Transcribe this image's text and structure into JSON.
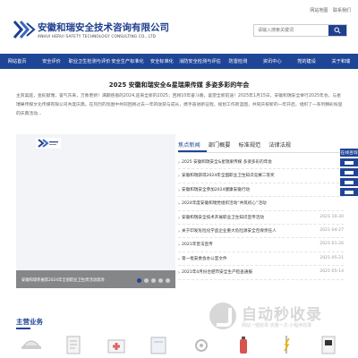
{
  "header": {
    "brand_cn": "安徽和瑞安全技术咨询有限公司",
    "brand_en": "ANHUI HERUI SAFETY TECHNOLOGY CONSULTING CO., LTD",
    "top_links": [
      "网站地图",
      "联系我们"
    ],
    "search_placeholder": "请输入搜索关键词"
  },
  "nav": {
    "items": [
      "网站首页",
      "安全评价",
      "职业卫生检测与评价",
      "安全生产标准化",
      "安全标准化",
      "消防安全检测与评估",
      "防雷检测",
      "资讯中心",
      "党的建设",
      "关于和瑞"
    ]
  },
  "article": {
    "title": "2025 安徽和瑞安全&星瑞果传媒 多姿多彩的年会",
    "body": "主宾宴庭，金蛇献瑞，誉气东来，万象更新！满期感恩的2024,迎来全新的2025；回顾10年奋斗路，喜望全新前途！2025年1月15日，安徽和瑞安全举行2025年会，与星瑞果传媒文化传媒有限公司共度庆典，在热烈的氛围中共同回顾过去一年的收获与成长，携手奋进新征程，规划工作新蓝图，共同庆祝新的一年开启，组织了一系列精彩纷呈的庆典活动..."
  },
  "slider": {
    "caption": "安徽和瑞参展第2024年全国职业卫生周活动现场",
    "dots": 5,
    "active_dot": 0
  },
  "news": {
    "tabs": [
      "焦点新闻",
      "部门概要",
      "标准规范",
      "法律法规"
    ],
    "active_tab": 0,
    "items": [
      {
        "text": "2025 安徽和瑞安全&星瑞果传媒 多姿多彩的年会",
        "date": ""
      },
      {
        "text": "安徽和瑞获得2024年全国职业卫生知识竞赛二等奖",
        "date": ""
      },
      {
        "text": "安徽和瑞安全参加2024健康安徽行动",
        "date": ""
      },
      {
        "text": "2024年度安徽和瑞党组织活动“共筑初心”活动",
        "date": ""
      },
      {
        "text": "安徽和瑞安全技术开展职业卫生知识宣传活动",
        "date": "2021-10-30"
      },
      {
        "text": "关于印发危险化学品企业重大危险源安全包保责任人",
        "date": "2021-04-27"
      },
      {
        "text": "2021年普法宣传",
        "date": "2021-01-26"
      },
      {
        "text": "第一批安委会办公室文件",
        "date": "2021-05-21"
      },
      {
        "text": "2021年4月份合肥市安全生产检查通报",
        "date": "2021-05-14"
      }
    ]
  },
  "floating": {
    "title": "在线咨询"
  },
  "section": {
    "title": "主营业务"
  },
  "watermark": {
    "text": "自动秒收录",
    "sub": "网站一键收录·流量一次·小程序收录"
  },
  "colors": {
    "primary": "#1f4596",
    "brand_dark": "#1f3f8f"
  }
}
